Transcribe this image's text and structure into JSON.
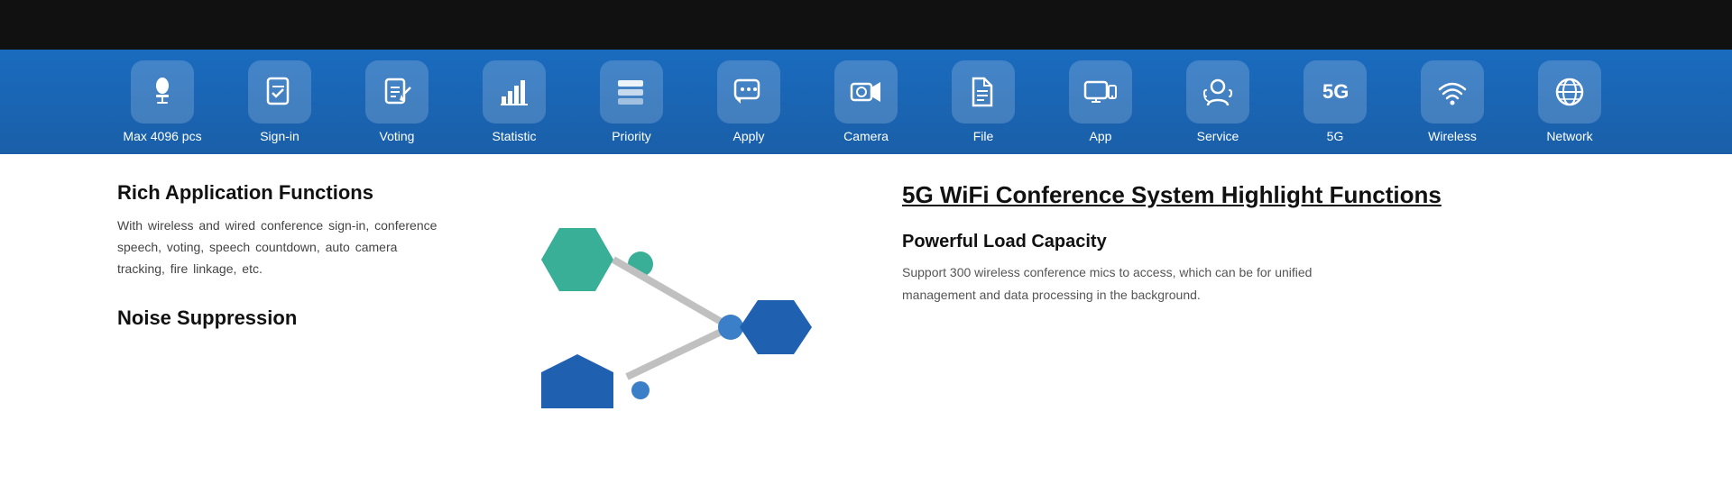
{
  "topBar": {},
  "iconBar": {
    "items": [
      {
        "id": "max4096",
        "label": "Max 4096 pcs",
        "icon": "mic"
      },
      {
        "id": "signin",
        "label": "Sign-in",
        "icon": "checklist"
      },
      {
        "id": "voting",
        "label": "Voting",
        "icon": "vote"
      },
      {
        "id": "statistic",
        "label": "Statistic",
        "icon": "chart"
      },
      {
        "id": "priority",
        "label": "Priority",
        "icon": "layers"
      },
      {
        "id": "apply",
        "label": "Apply",
        "icon": "chat"
      },
      {
        "id": "camera",
        "label": "Camera",
        "icon": "camera"
      },
      {
        "id": "file",
        "label": "File",
        "icon": "folder"
      },
      {
        "id": "app",
        "label": "App",
        "icon": "tablet"
      },
      {
        "id": "service",
        "label": "Service",
        "icon": "headset"
      },
      {
        "id": "fiveg",
        "label": "5G",
        "icon": "5g"
      },
      {
        "id": "wireless",
        "label": "Wireless",
        "icon": "wifi"
      },
      {
        "id": "network",
        "label": "Network",
        "icon": "globe"
      }
    ]
  },
  "content": {
    "leftTitle": "Rich Application Functions",
    "leftText": "With wireless and wired conference sign-in, conference speech, voting, speech countdown, auto camera tracking, fire linkage, etc.",
    "noiseTitle": "Noise Suppression",
    "rightMainTitle": "5G WiFi Conference System  Highlight Functions",
    "rightSubTitle": "Powerful Load Capacity",
    "rightText": "Support 300 wireless conference mics to access, which can be  for unified management and data processing in the background."
  }
}
